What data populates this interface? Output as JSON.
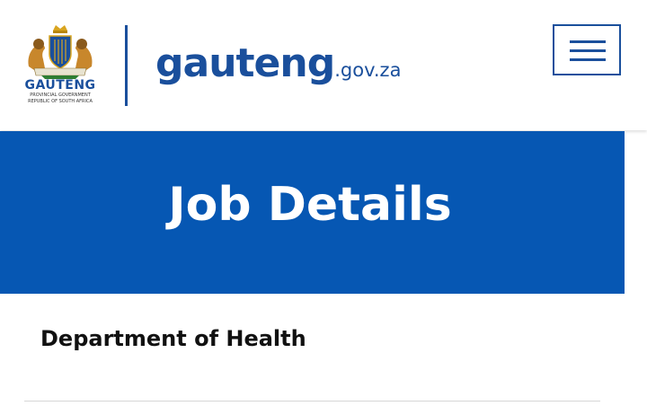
{
  "header": {
    "crest": {
      "icon": "coat-of-arms-icon",
      "name": "GAUTENG",
      "subtitle_line1": "PROVINCIAL GOVERNMENT",
      "subtitle_line2": "REPUBLIC OF SOUTH AFRICA"
    },
    "logo": {
      "main": "gauteng",
      "suffix": ".gov.za"
    },
    "menu": {
      "icon": "hamburger-menu-icon"
    }
  },
  "banner": {
    "title": "Job Details"
  },
  "content": {
    "department": "Department of Health"
  },
  "colors": {
    "brand_blue": "#1a4f9c",
    "banner_blue": "#0657b3",
    "banner_text": "#ffffff"
  }
}
